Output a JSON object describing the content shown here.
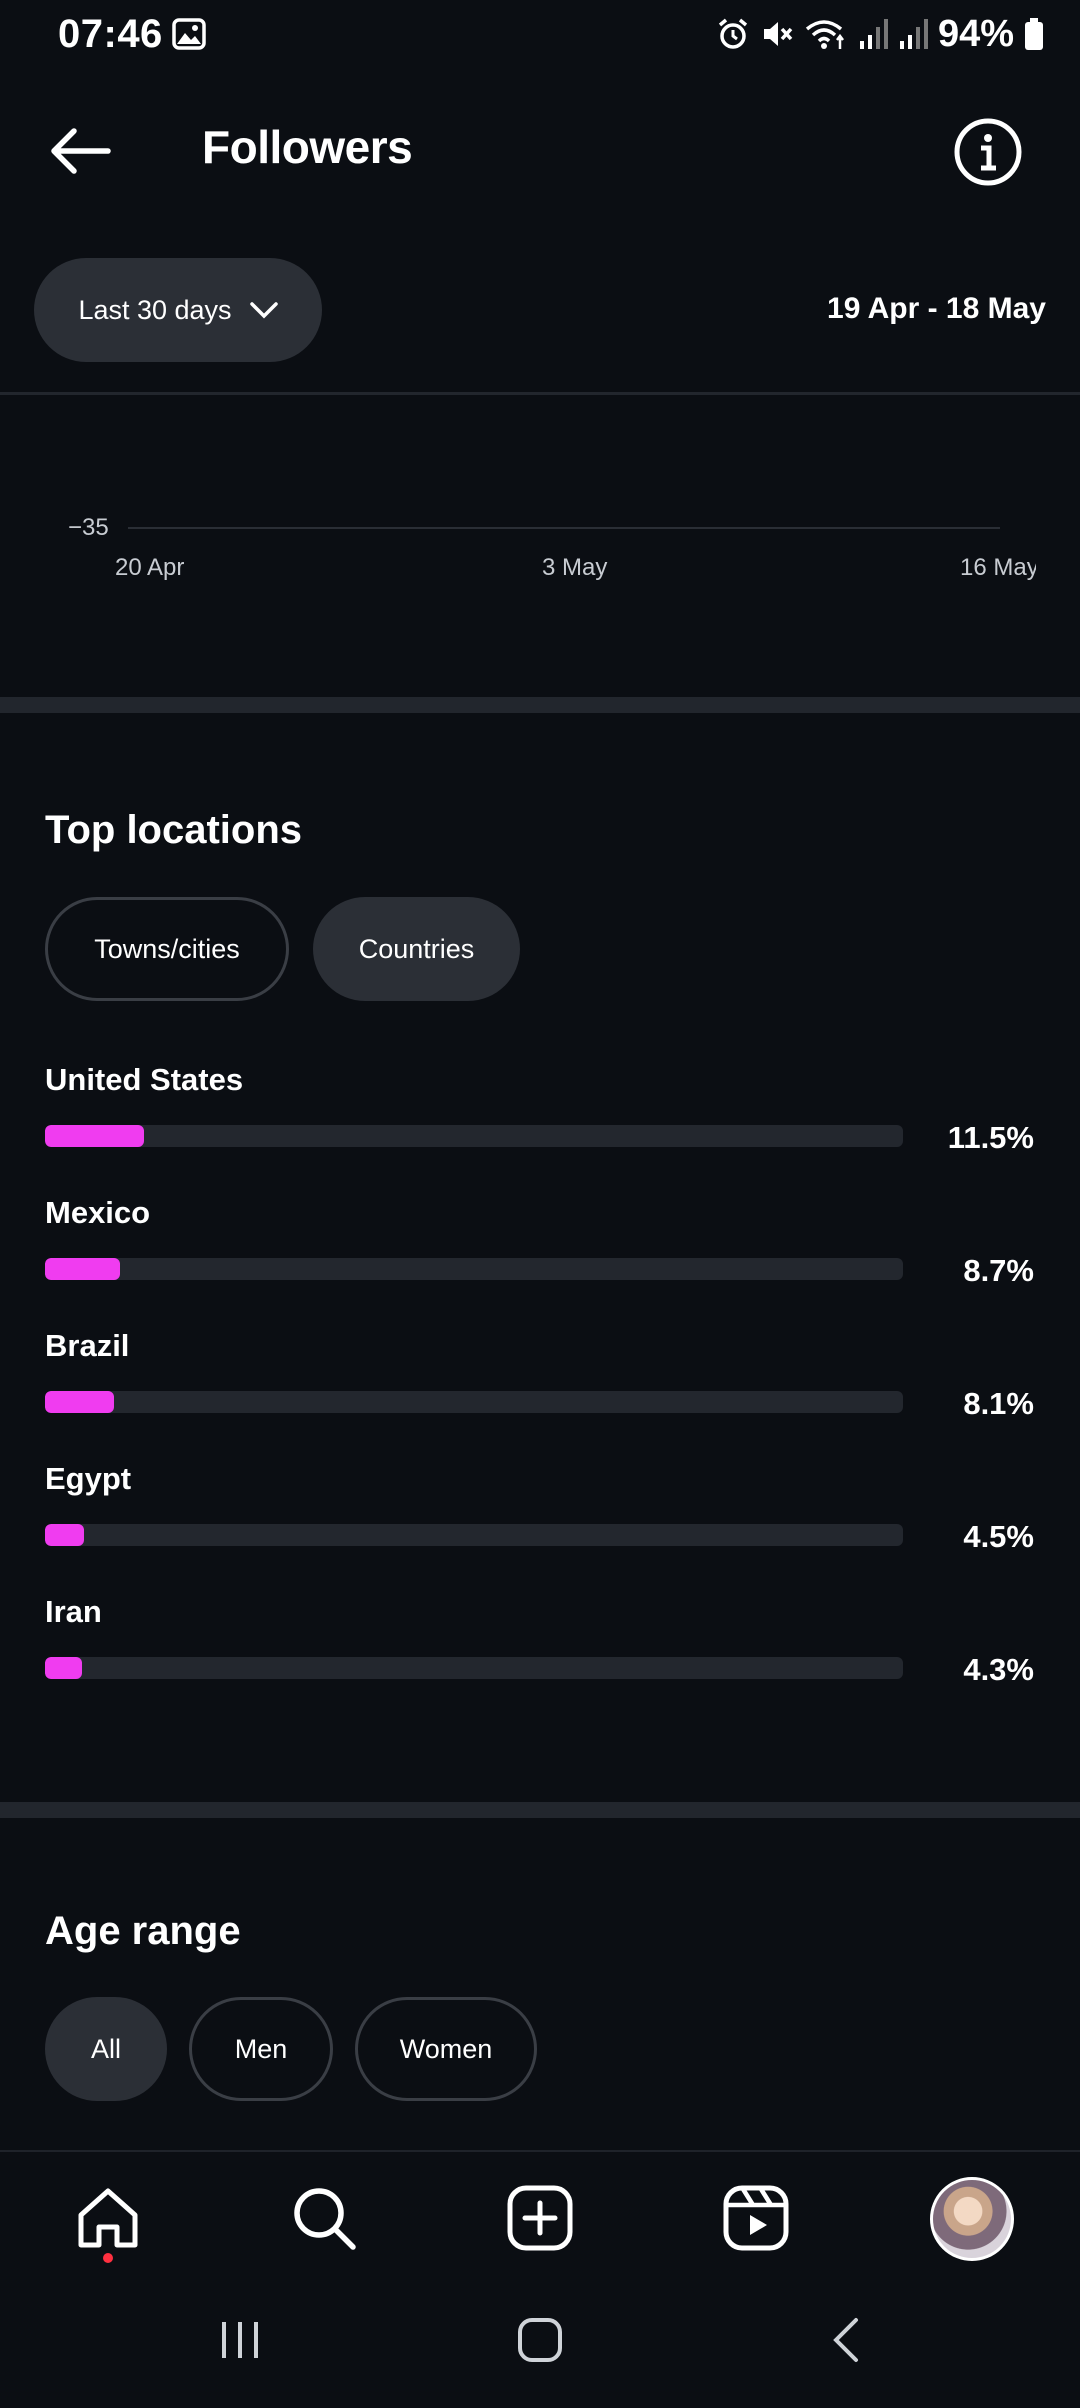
{
  "status_bar": {
    "time": "07:46",
    "battery_text": "94%",
    "icons": [
      "image-icon",
      "alarm-icon",
      "mute-icon",
      "wifi-icon",
      "signal-icon",
      "signal-icon",
      "battery-icon"
    ]
  },
  "header": {
    "title": "Followers",
    "back_icon": "back-arrow-icon",
    "info_icon": "info-icon"
  },
  "filter": {
    "period_label": "Last 30 days",
    "date_range": "19 Apr - 18 May"
  },
  "chart_data": {
    "type": "line",
    "title": "",
    "xlabel": "",
    "ylabel": "",
    "y_ticks": [
      "−35"
    ],
    "x_ticks": [
      "20 Apr",
      "3 May",
      "16 May"
    ],
    "grid": true,
    "series": []
  },
  "top_locations": {
    "title": "Top locations",
    "tabs": [
      {
        "label": "Towns/cities",
        "selected": false
      },
      {
        "label": "Countries",
        "selected": true
      }
    ],
    "items": [
      {
        "name": "United States",
        "percent_label": "11.5%",
        "value": 11.5
      },
      {
        "name": "Mexico",
        "percent_label": "8.7%",
        "value": 8.7
      },
      {
        "name": "Brazil",
        "percent_label": "8.1%",
        "value": 8.1
      },
      {
        "name": "Egypt",
        "percent_label": "4.5%",
        "value": 4.5
      },
      {
        "name": "Iran",
        "percent_label": "4.3%",
        "value": 4.3
      }
    ],
    "bar_color": "#f03cf0"
  },
  "age_range": {
    "title": "Age range",
    "tabs": [
      {
        "label": "All",
        "selected": true
      },
      {
        "label": "Men",
        "selected": false
      },
      {
        "label": "Women",
        "selected": false
      }
    ]
  },
  "bottom_nav": {
    "items": [
      "home-icon",
      "search-icon",
      "create-icon",
      "reels-icon",
      "profile-avatar"
    ]
  },
  "colors": {
    "background": "#0b0e13",
    "accent": "#f03cf0",
    "notification_dot": "#ff3040"
  }
}
